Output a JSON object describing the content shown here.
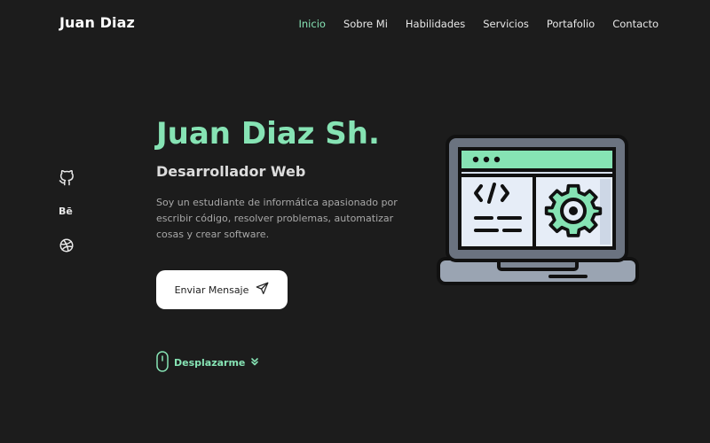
{
  "header": {
    "logo": "Juan Diaz",
    "nav": [
      "Inicio",
      "Sobre Mi",
      "Habilidades",
      "Servicios",
      "Portafolio",
      "Contacto"
    ],
    "active_index": 0
  },
  "social": {
    "items": [
      {
        "icon": "github-icon"
      },
      {
        "icon": "behance-icon",
        "label": "Bē"
      },
      {
        "icon": "dribbble-icon"
      }
    ]
  },
  "hero": {
    "title": "Juan Diaz Sh.",
    "subtitle": "Desarrollador Web",
    "description": "Soy un estudiante de informática apasionado por escribir código, resolver problemas, automatizar cosas y crear software.",
    "button_label": "Enviar Mensaje",
    "button_icon": "send-icon",
    "scroll_label": "Desplazarme",
    "scroll_icon": "mouse-icon",
    "illustration": "laptop-code-settings-icon"
  },
  "colors": {
    "background": "#1c1c1c",
    "accent": "#86e3b4",
    "text": "#e8e8e8",
    "muted": "#a8a8a8"
  }
}
